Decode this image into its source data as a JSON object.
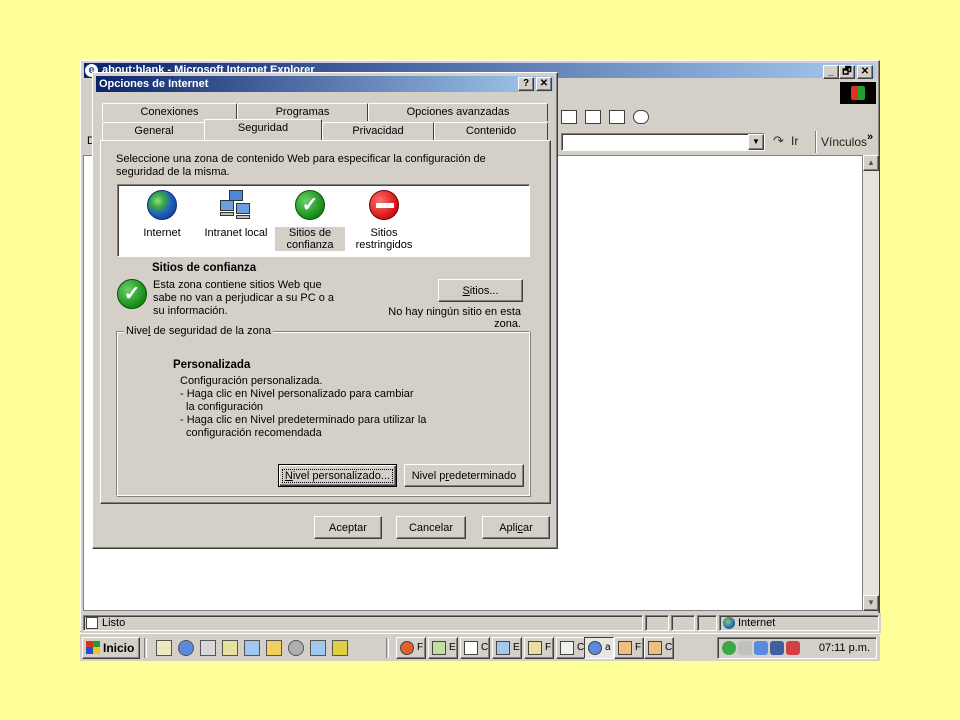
{
  "ie_window": {
    "title": "about:blank - Microsoft Internet Explorer",
    "buttons": {
      "minimize": "_",
      "maximize": "🗗",
      "close": "✕"
    },
    "address_label": "D",
    "go_label": "Ir",
    "links_label": "Vínculos",
    "links_chevron": "»",
    "status": {
      "text": "Listo",
      "zone": "Internet"
    }
  },
  "dialog": {
    "title": "Opciones de Internet",
    "help_button": "?",
    "close_button": "✕",
    "tabs_back_row": [
      "Conexiones",
      "Programas",
      "Opciones avanzadas"
    ],
    "tabs_front_row": [
      "General",
      "Seguridad",
      "Privacidad",
      "Contenido"
    ],
    "active_tab": "Seguridad",
    "instruction": "Seleccione una zona de contenido Web para especificar la configuración de seguridad de la misma.",
    "zones": [
      {
        "label": "Internet",
        "icon": "globe-icon"
      },
      {
        "label": "Intranet local",
        "icon": "local-intranet-icon"
      },
      {
        "label": "Sitios de confianza",
        "icon": "trusted-sites-icon"
      },
      {
        "label": "Sitios restringidos",
        "icon": "restricted-sites-icon"
      }
    ],
    "selected_zone": "Sitios de confianza",
    "zone_info": {
      "heading": "Sitios de confianza",
      "description": "Esta zona contiene sitios Web que sabe no van a perjudicar a su PC o a su información.",
      "sites_button_pre": "",
      "sites_button_u": "S",
      "sites_button_post": "itios...",
      "no_sites_note": "No hay ningún sitio en esta zona."
    },
    "security_level": {
      "group_label_pre": "Nive",
      "group_label_u": "l",
      "group_label_post": " de seguridad de la zona",
      "heading": "Personalizada",
      "lines": [
        "Configuración personalizada.",
        "- Haga clic en Nivel personalizado para cambiar",
        "  la configuración",
        "- Haga clic en Nivel predeterminado para utilizar la",
        "  configuración recomendada"
      ],
      "custom_button_pre": "",
      "custom_button_u": "N",
      "custom_button_post": "ivel personalizado...",
      "default_button_pre": "Nivel p",
      "default_button_u": "r",
      "default_button_post": "edeterminado"
    },
    "footer": {
      "ok": "Aceptar",
      "cancel": "Cancelar",
      "apply_pre": "Apli",
      "apply_u": "c",
      "apply_post": "ar"
    }
  },
  "taskbar": {
    "start_label": "Inicio",
    "clock": "07:11 p.m.",
    "task_letters": [
      "F",
      "E",
      "C",
      "E",
      "F",
      "C",
      "a",
      "F",
      "C"
    ]
  },
  "colors": {
    "desktop": "#ffff99",
    "face": "#d4d0c8",
    "title_gradient_start": "#0a246a",
    "title_gradient_end": "#a6caf0"
  }
}
